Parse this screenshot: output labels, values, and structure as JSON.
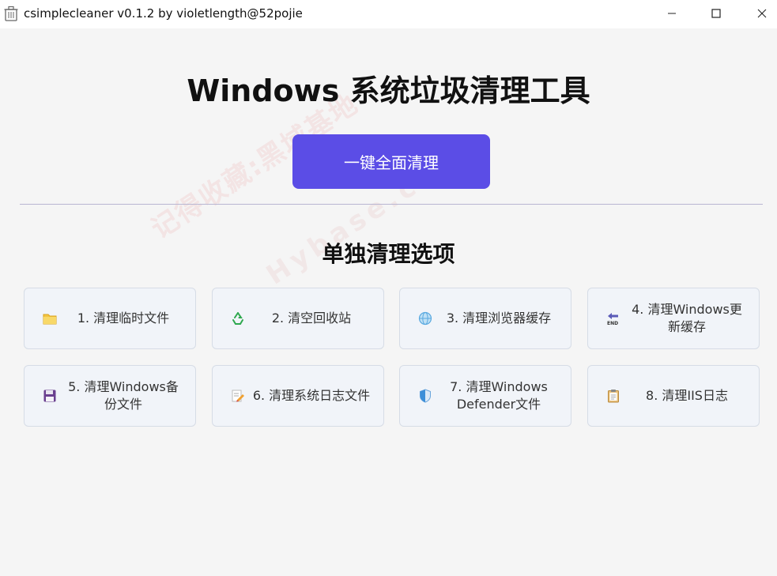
{
  "window": {
    "title": "csimplecleaner v0.1.2 by violetlength@52pojie"
  },
  "main": {
    "heading": "Windows 系统垃圾清理工具",
    "clean_all_label": "一键全面清理",
    "section_title": "单独清理选项"
  },
  "options": [
    {
      "label": "1. 清理临时文件",
      "icon": "folder-icon"
    },
    {
      "label": "2. 清空回收站",
      "icon": "recycle-icon"
    },
    {
      "label": "3. 清理浏览器缓存",
      "icon": "globe-icon"
    },
    {
      "label": "4. 清理Windows更新缓存",
      "icon": "end-arrow-icon"
    },
    {
      "label": "5. 清理Windows备份文件",
      "icon": "floppy-disk-icon"
    },
    {
      "label": "6. 清理系统日志文件",
      "icon": "memo-icon"
    },
    {
      "label": "7. 清理Windows Defender文件",
      "icon": "shield-icon"
    },
    {
      "label": "8. 清理IIS日志",
      "icon": "clipboard-icon"
    }
  ],
  "watermark": {
    "text_1": "记得收藏:黑域基地",
    "text_2": "Hybase.com"
  },
  "colors": {
    "accent": "#5b4de6",
    "card_bg": "#f1f4f9",
    "background": "#f5f5f5"
  }
}
